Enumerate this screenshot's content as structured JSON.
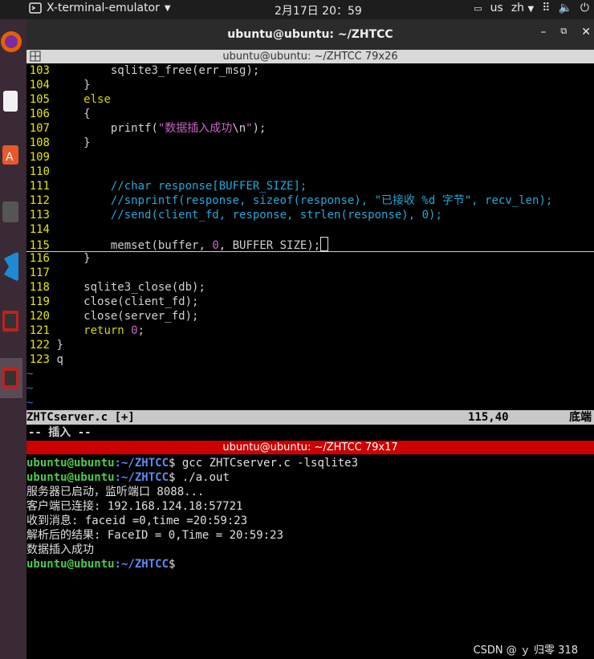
{
  "topbar": {
    "app_name": "X-terminal-emulator",
    "clock": "2月17日  20：59",
    "input_method": "us",
    "language": "zh"
  },
  "window": {
    "title": "ubuntu@ubuntu: ~/ZHTCC"
  },
  "editor_pane": {
    "title": "ubuntu@ubuntu: ~/ZHTCC 79x26",
    "lines": [
      {
        "n": "103",
        "segments": [
          {
            "t": "        sqlite3_free(err_msg);",
            "c": "code"
          }
        ]
      },
      {
        "n": "104",
        "segments": [
          {
            "t": "    }",
            "c": "code"
          }
        ]
      },
      {
        "n": "105",
        "segments": [
          {
            "t": "    ",
            "c": "code"
          },
          {
            "t": "else",
            "c": "kw"
          }
        ]
      },
      {
        "n": "106",
        "segments": [
          {
            "t": "    {",
            "c": "code"
          }
        ]
      },
      {
        "n": "107",
        "segments": [
          {
            "t": "        printf(",
            "c": "code"
          },
          {
            "t": "\"数据插入成功",
            "c": "st"
          },
          {
            "t": "\\n",
            "c": "code"
          },
          {
            "t": "\"",
            "c": "st"
          },
          {
            "t": ");",
            "c": "code"
          }
        ]
      },
      {
        "n": "108",
        "segments": [
          {
            "t": "    }",
            "c": "code"
          }
        ]
      },
      {
        "n": "109",
        "segments": []
      },
      {
        "n": "110",
        "segments": []
      },
      {
        "n": "111",
        "segments": [
          {
            "t": "        //char response[BUFFER_SIZE];",
            "c": "cm"
          }
        ]
      },
      {
        "n": "112",
        "segments": [
          {
            "t": "        //snprintf(response, sizeof(response), \"已接收 %d 字节\", recv_len);",
            "c": "cm"
          }
        ]
      },
      {
        "n": "113",
        "segments": [
          {
            "t": "        //send(client_fd, response, strlen(response), 0);",
            "c": "cm"
          }
        ]
      },
      {
        "n": "114",
        "segments": []
      },
      {
        "n": "115",
        "segments": [
          {
            "t": "        memset(buffer, ",
            "c": "code"
          },
          {
            "t": "0",
            "c": "nm"
          },
          {
            "t": ", BUFFER_SIZE);",
            "c": "code"
          }
        ],
        "cursor": true
      },
      {
        "n": "116",
        "segments": [
          {
            "t": "    }",
            "c": "code"
          }
        ]
      },
      {
        "n": "117",
        "segments": []
      },
      {
        "n": "118",
        "segments": [
          {
            "t": "    sqlite3_close(db);",
            "c": "code"
          }
        ]
      },
      {
        "n": "119",
        "segments": [
          {
            "t": "    close(client_fd);",
            "c": "code"
          }
        ]
      },
      {
        "n": "120",
        "segments": [
          {
            "t": "    close(server_fd);",
            "c": "code"
          }
        ]
      },
      {
        "n": "121",
        "segments": [
          {
            "t": "    ",
            "c": "code"
          },
          {
            "t": "return",
            "c": "kw"
          },
          {
            "t": " ",
            "c": "code"
          },
          {
            "t": "0",
            "c": "nm"
          },
          {
            "t": ";",
            "c": "code"
          }
        ]
      },
      {
        "n": "122",
        "segments": [
          {
            "t": "}",
            "c": "code"
          }
        ]
      },
      {
        "n": "123",
        "segments": [
          {
            "t": "q",
            "c": "code"
          }
        ]
      }
    ],
    "empty_marker": "~",
    "empty_count": 3,
    "status_file": "ZHTCserver.c [+]",
    "status_position": "115,40",
    "status_percent": "底端",
    "mode": "-- 插入 --"
  },
  "shell_pane": {
    "title": "ubuntu@ubuntu: ~/ZHTCC 79x17",
    "prompt_user": "ubuntu@ubuntu",
    "prompt_path": ":~/ZHTCC",
    "prompt_sign": "$",
    "lines": [
      {
        "prompt": true,
        "text": " gcc ZHTCserver.c -lsqlite3"
      },
      {
        "prompt": true,
        "text": " ./a.out"
      },
      {
        "prompt": false,
        "text": "服务器已启动，监听端口 8088..."
      },
      {
        "prompt": false,
        "text": "客户端已连接: 192.168.124.18:57721"
      },
      {
        "prompt": false,
        "text": "收到消息: faceid =0,time =20:59:23"
      },
      {
        "prompt": false,
        "text": "解析后的结果: FaceID = 0,Time = 20:59:23"
      },
      {
        "prompt": false,
        "text": "数据插入成功"
      },
      {
        "prompt": true,
        "text": ""
      }
    ]
  },
  "watermark": "CSDN @ ｙ 归零 318"
}
